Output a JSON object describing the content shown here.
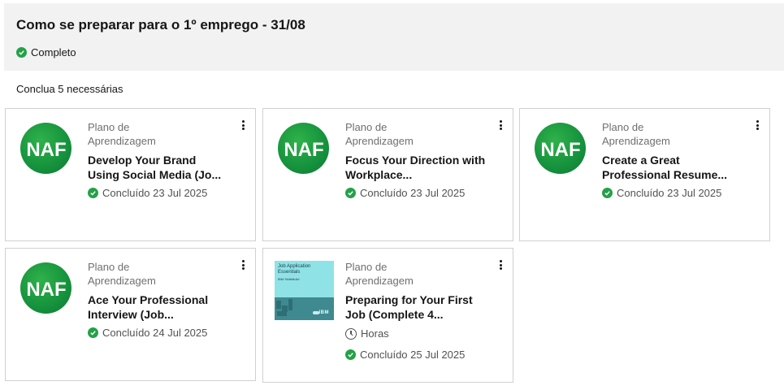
{
  "header": {
    "title": "Como se preparar para o 1º emprego - 31/08",
    "status": "Completo",
    "status_color": "#24a148"
  },
  "requirement_text": "Conclua 5 necessárias",
  "logo_text": "NAF",
  "cards": [
    {
      "type": "Plano de Aprendizagem",
      "title": "Develop Your Brand Using Social Media (Jo...",
      "status": "Concluído 23 Jul 2025",
      "image": "naf-logo"
    },
    {
      "type": "Plano de Aprendizagem",
      "title": "Focus Your Direction with Workplace...",
      "status": "Concluído 23 Jul 2025",
      "image": "naf-logo"
    },
    {
      "type": "Plano de Aprendizagem",
      "title": "Create a Great Professional Resume...",
      "status": "Concluído 23 Jul 2025",
      "image": "naf-logo"
    },
    {
      "type": "Plano de Aprendizagem",
      "title": "Ace Your Professional Interview (Job...",
      "status": "Concluído 24 Jul 2025",
      "image": "naf-logo"
    },
    {
      "type": "Plano de Aprendizagem",
      "title": "Preparing for Your First Job (Complete 4...",
      "duration": "Horas",
      "status": "Concluído 25 Jul 2025",
      "image": "job-application-thumbnail",
      "thumbnail": {
        "title": "Job Application Essentials",
        "subtitle": "IBM SkillsBuild",
        "brand": "IBM"
      }
    }
  ],
  "icons": {
    "status": "checkmark-filled-icon",
    "menu": "overflow-menu-vertical-icon",
    "duration": "clock-icon"
  }
}
